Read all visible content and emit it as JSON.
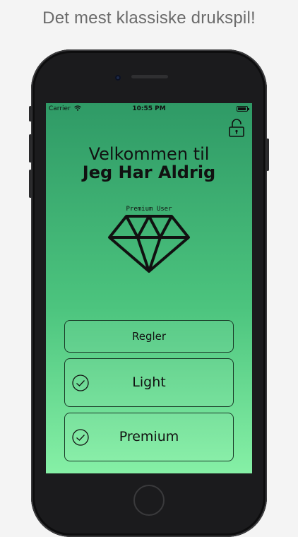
{
  "promo": {
    "headline": "Det mest klassiske drukspil!"
  },
  "status_bar": {
    "carrier": "Carrier",
    "time": "10:55 PM"
  },
  "home": {
    "welcome": "Velkommen til",
    "app_name": "Jeg Har Aldrig",
    "premium_label": "Premium User"
  },
  "buttons": {
    "rules": "Regler",
    "light": "Light",
    "premium": "Premium"
  },
  "icons": {
    "lock": "unlocked-padlock-icon",
    "diamond": "diamond-icon",
    "check": "checkmark-circle-icon"
  },
  "colors": {
    "gradient_top": "#2f9a66",
    "gradient_bottom": "#86f0a6",
    "outline": "#1a3a28"
  }
}
